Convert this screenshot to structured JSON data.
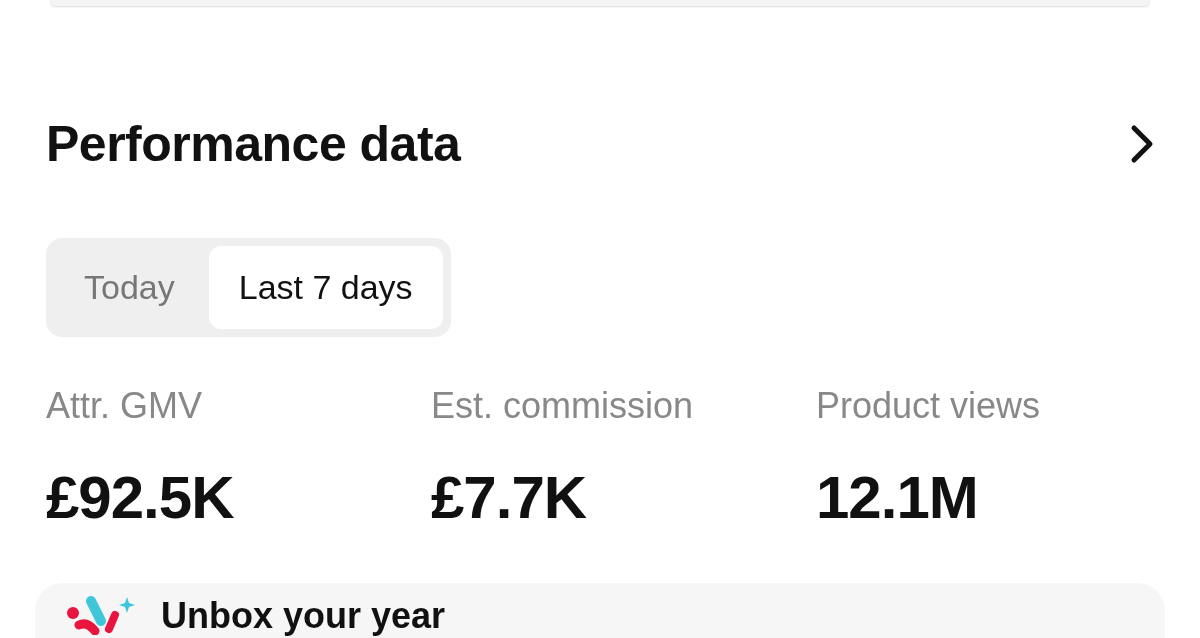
{
  "header": {
    "title": "Performance data"
  },
  "period_tabs": [
    {
      "label": "Today",
      "selected": false
    },
    {
      "label": "Last 7 days",
      "selected": true
    }
  ],
  "metrics": [
    {
      "label": "Attr. GMV",
      "value": "£92.5K"
    },
    {
      "label": "Est. commission",
      "value": "£7.7K"
    },
    {
      "label": "Product views",
      "value": "12.1M"
    }
  ],
  "promo_card": {
    "title": "Unbox your year"
  }
}
